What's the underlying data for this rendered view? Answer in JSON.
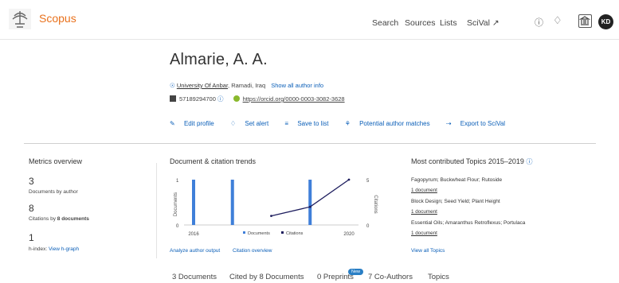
{
  "header": {
    "brand": "Scopus",
    "nav": [
      "Search",
      "Sources",
      "Lists",
      "SciVal ↗"
    ],
    "avatar": "KD"
  },
  "author": {
    "name": "Almarie, A. A.",
    "affiliation": "University Of Anbar",
    "location": ", Ramadi, Iraq",
    "show_info": "Show all author info",
    "scopus_id": "57189294700",
    "orcid": "https://orcid.org/0000-0003-3082-3628"
  },
  "actions": [
    "Edit profile",
    "Set alert",
    "Save to list",
    "Potential author matches",
    "Export to SciVal"
  ],
  "metrics": {
    "title": "Metrics overview",
    "docs_value": "3",
    "docs_label": "Documents by author",
    "citations_value": "8",
    "citations_label_pre": "Citations by ",
    "citations_label_bold": "8 documents",
    "hindex_value": "1",
    "hindex_label": "h-index:",
    "hindex_link": "View h-graph"
  },
  "trends": {
    "title": "Document & citation trends",
    "analyze_link": "Analyze author output",
    "citation_link": "Citation overview"
  },
  "chart_data": {
    "type": "bar",
    "x": [
      2016,
      2017,
      2018,
      2019,
      2020
    ],
    "x_ticks": [
      "2016",
      "2020"
    ],
    "ylabel_left": "Documents",
    "ylabel_right": "Citations",
    "yticks_left": [
      "1",
      "0"
    ],
    "yticks_right": [
      "5",
      "0"
    ],
    "ylim_left": [
      0,
      1
    ],
    "ylim_right": [
      0,
      5
    ],
    "series": [
      {
        "name": "Documents",
        "kind": "bar",
        "color": "#3f7fd9",
        "values": [
          1,
          1,
          0,
          1,
          0
        ]
      },
      {
        "name": "Citations",
        "kind": "line",
        "color": "#1d1d5e",
        "values": [
          null,
          null,
          1,
          2,
          5
        ]
      }
    ],
    "legend": "bottom"
  },
  "topics": {
    "title": "Most contributed Topics 2015–2019",
    "items": [
      {
        "name": "Fagopyrum; Buckwheat Flour; Rutoside",
        "count": "1 document"
      },
      {
        "name": "Block Design; Seed Yield; Plant Height",
        "count": "1 document"
      },
      {
        "name": "Essential Oils; Amaranthus Retroflexus; Portulaca",
        "count": "1 document"
      }
    ],
    "view_all": "View all Topics"
  },
  "tabs": [
    "3 Documents",
    "Cited by 8 Documents",
    "0 Preprints",
    "7 Co-Authors",
    "Topics"
  ],
  "new_badge": "New"
}
